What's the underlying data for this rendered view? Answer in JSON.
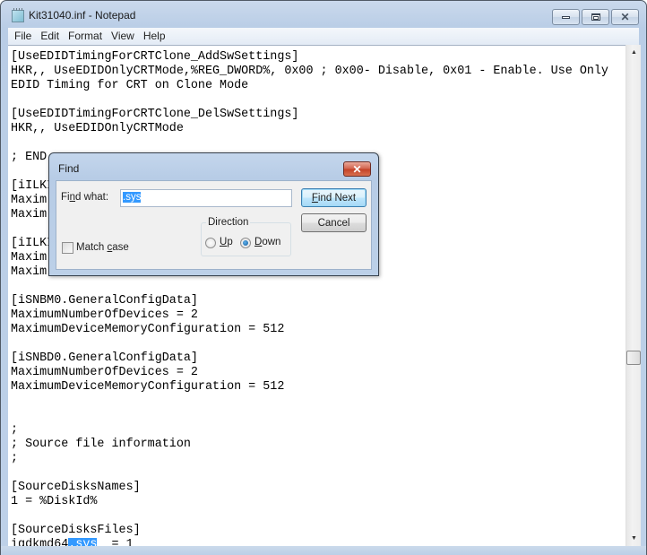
{
  "window": {
    "title": "Kit31040.inf - Notepad",
    "icon": "notepad-icon",
    "controls": {
      "minimize": "minimize-icon",
      "maximize": "maximize-icon",
      "close": "✕"
    }
  },
  "menu": [
    {
      "label": "File"
    },
    {
      "label": "Edit"
    },
    {
      "label": "Format"
    },
    {
      "label": "View"
    },
    {
      "label": "Help"
    }
  ],
  "editor": {
    "lines": [
      "[UseEDIDTimingForCRTClone_AddSwSettings]",
      "HKR,, UseEDIDOnlyCRTMode,%REG_DWORD%, 0x00 ; 0x00- Disable, 0x01 - Enable. Use Only",
      "EDID Timing for CRT on Clone Mode",
      "",
      "[UseEDIDTimingForCRTClone_DelSwSettings]",
      "HKR,, UseEDIDOnlyCRTMode",
      "",
      "; END",
      "",
      "[iILKI",
      "Maxim",
      "Maxim",
      "",
      "[iILKI",
      "Maxim",
      "Maxim",
      "",
      "[iSNBM0.GeneralConfigData]",
      "MaximumNumberOfDevices = 2",
      "MaximumDeviceMemoryConfiguration = 512",
      "",
      "[iSNBD0.GeneralConfigData]",
      "MaximumNumberOfDevices = 2",
      "MaximumDeviceMemoryConfiguration = 512",
      "",
      "",
      ";",
      "; Source file information",
      ";",
      "",
      "[SourceDisksNames]",
      "1 = %DiskId%",
      "",
      "[SourceDisksFiles]"
    ],
    "last_line": {
      "before": "igdkmd64",
      "selected": ".sys",
      "after": "  = 1"
    }
  },
  "scrollbar": {
    "up_arrow": "▲",
    "down_arrow": "▼",
    "position_fraction": 0.62
  },
  "find_dialog": {
    "title": "Find",
    "close": "✕",
    "find_what_label_pre": "Fi",
    "find_what_label_ul": "n",
    "find_what_label_post": "d what:",
    "find_what_value": ".sys",
    "find_next_ul": "F",
    "find_next_rest": "ind Next",
    "cancel_label": "Cancel",
    "direction_label": "Direction",
    "up_ul": "U",
    "up_rest": "p",
    "down_ul": "D",
    "down_rest": "own",
    "direction_selected": "Down",
    "match_case_pre": "Match ",
    "match_case_ul": "c",
    "match_case_post": "ase",
    "match_case_checked": false
  }
}
